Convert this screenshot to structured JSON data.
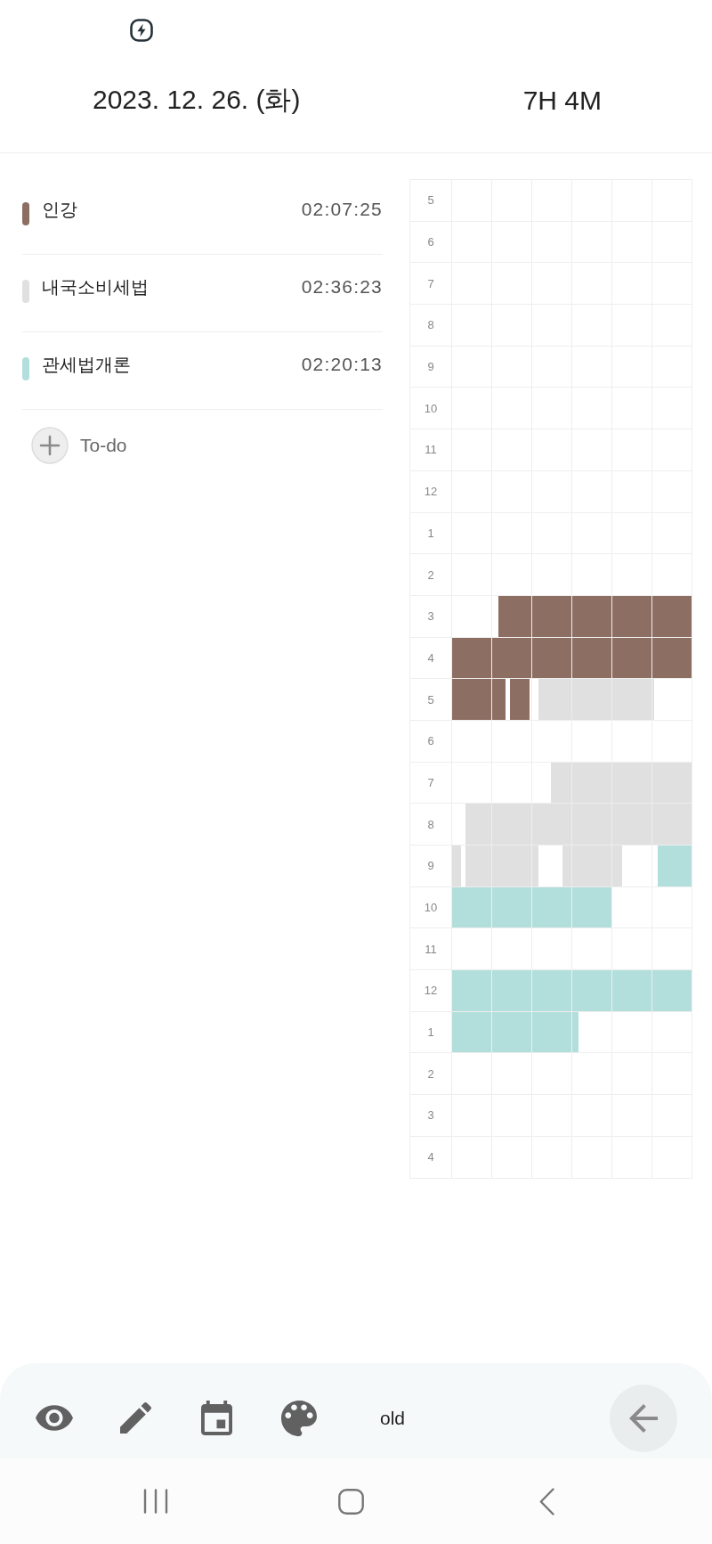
{
  "header": {
    "date": "2023. 12. 26. (화)",
    "total": "7H 4M"
  },
  "subjects": [
    {
      "name": "인강",
      "time": "02:07:25",
      "color": "#8d6e63"
    },
    {
      "name": "내국소비세법",
      "time": "02:36:23",
      "color": "#e0e0e0"
    },
    {
      "name": "관세법개론",
      "time": "02:20:13",
      "color": "#b2dfdb"
    }
  ],
  "add_todo": {
    "label": "To-do"
  },
  "timetable": {
    "hours": [
      "5",
      "6",
      "7",
      "8",
      "9",
      "10",
      "11",
      "12",
      "1",
      "2",
      "3",
      "4",
      "5",
      "6",
      "7",
      "8",
      "9",
      "10",
      "11",
      "12",
      "1",
      "2",
      "3",
      "4"
    ]
  },
  "toolbar": {
    "mode_label": "old"
  }
}
